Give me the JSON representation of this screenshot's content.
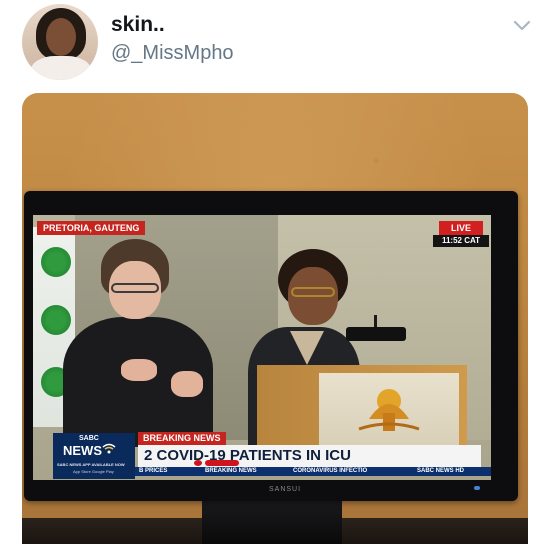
{
  "tweet": {
    "display_name": "skin..",
    "handle": "@_MissMpho"
  },
  "icons": {
    "menu": "chevron-down-icon"
  },
  "broadcast": {
    "location": "PRETORIA, GAUTENG",
    "live_label": "LIVE",
    "live_time": "11:52 CAT",
    "breaking_label": "BREAKING NEWS",
    "headline": "2 COVID-19 PATIENTS IN ICU",
    "logo_sabc": "SABC",
    "logo_news": "NEWS",
    "logo_app_line": "SABC NEWS APP AVAILABLE NOW",
    "logo_app_line2": "App Store   Google Play",
    "ticker": [
      "B PRICES",
      "BREAKING NEWS",
      "CORONAVIRUS INFECTIO",
      "SABC NEWS HD"
    ],
    "tv_brand": "SANSUI"
  },
  "colors": {
    "name": "#14171a",
    "handle": "#657786",
    "breaking_red": "#c4261f",
    "ticker_blue": "#0c2f6e"
  }
}
